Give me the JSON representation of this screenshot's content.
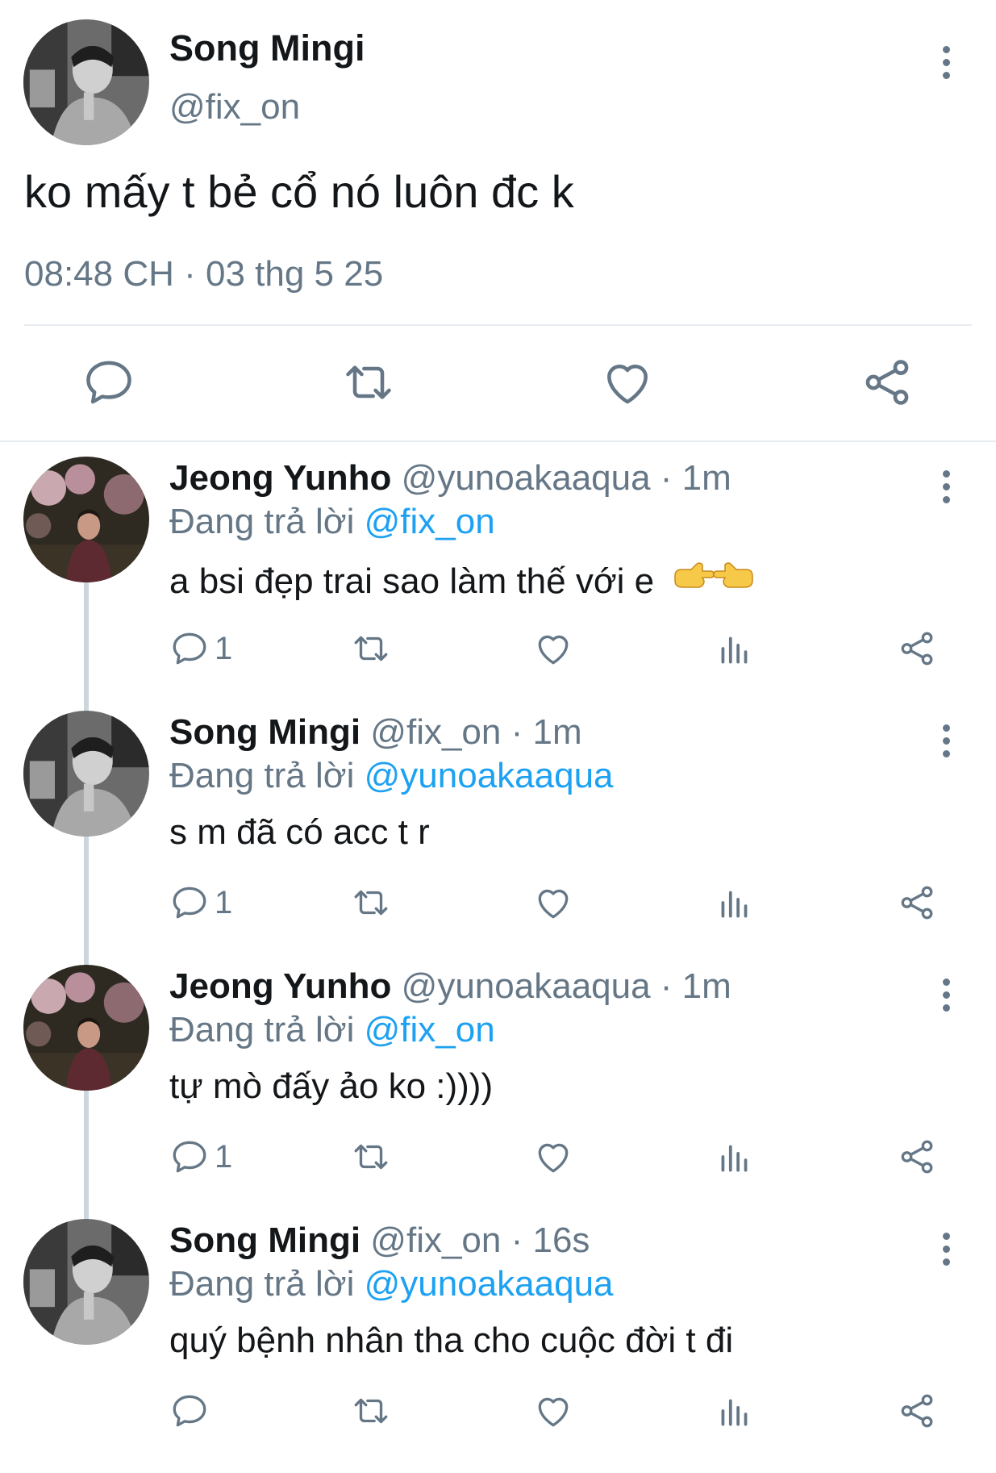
{
  "main_tweet": {
    "author_name": "Song Mingi",
    "author_handle": "@fix_on",
    "text": "ko mấy t bẻ cổ nó luôn đc k",
    "timestamp": "08:48 CH · 03 thg 5 25",
    "more_icon": "more-vertical-icon",
    "actions": [
      {
        "icon": "reply-icon"
      },
      {
        "icon": "retweet-icon"
      },
      {
        "icon": "like-icon"
      },
      {
        "icon": "share-icon"
      }
    ]
  },
  "replies": [
    {
      "name": "Jeong Yunho",
      "meta": "@yunoakaaqua · 1m",
      "replying_prefix": "Đang trả lời ",
      "replying_to": "@fix_on",
      "text": "a bsi đẹp trai sao làm thế với e",
      "has_emoji": true,
      "emoji_icons": [
        "pointing-right-hand-icon",
        "pointing-left-hand-icon"
      ],
      "reply_count": "1",
      "avatar": "yunho"
    },
    {
      "name": "Song Mingi",
      "meta": "@fix_on · 1m",
      "replying_prefix": "Đang trả lời ",
      "replying_to": "@yunoakaaqua",
      "text": "s m đã có acc t r",
      "has_emoji": false,
      "reply_count": "1",
      "avatar": "mingi"
    },
    {
      "name": "Jeong Yunho",
      "meta": "@yunoakaaqua · 1m",
      "replying_prefix": "Đang trả lời ",
      "replying_to": "@fix_on",
      "text": "tự mò đấy ảo ko :))))",
      "has_emoji": false,
      "reply_count": "1",
      "avatar": "yunho"
    },
    {
      "name": "Song Mingi",
      "meta": "@fix_on · 16s",
      "replying_prefix": "Đang trả lời ",
      "replying_to": "@yunoakaaqua",
      "text": "quý bệnh nhân tha cho cuộc đời t đi",
      "has_emoji": false,
      "reply_count": "",
      "avatar": "mingi"
    }
  ],
  "colors": {
    "text_primary": "#14171a",
    "text_secondary": "#657786",
    "mention": "#1da1f2",
    "divider": "#e6ecf0",
    "thread_line": "#ccd6dd",
    "icon": "#657786"
  }
}
